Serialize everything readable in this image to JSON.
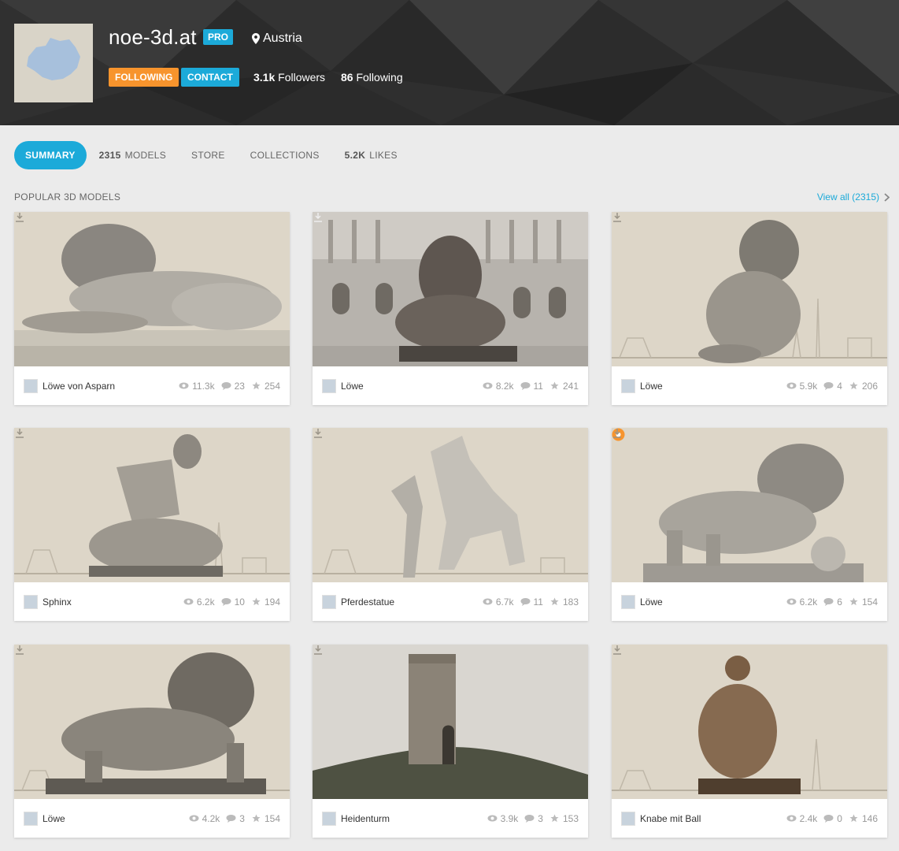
{
  "profile": {
    "name": "noe-3d.at",
    "badge": "PRO",
    "location": "Austria",
    "follow_label": "FOLLOWING",
    "contact_label": "CONTACT",
    "followers_count": "3.1k",
    "followers_label": "Followers",
    "following_count": "86",
    "following_label": "Following"
  },
  "tabs": {
    "summary": "SUMMARY",
    "models_count": "2315",
    "models": "MODELS",
    "store": "STORE",
    "collections": "COLLECTIONS",
    "likes_count": "5.2K",
    "likes": "LIKES"
  },
  "section": {
    "title": "POPULAR 3D MODELS",
    "view_all": "View all (2315)"
  },
  "models": [
    {
      "name": "Löwe von Asparn",
      "views": "11.3k",
      "comments": "23",
      "likes": "254"
    },
    {
      "name": "Löwe",
      "views": "8.2k",
      "comments": "11",
      "likes": "241"
    },
    {
      "name": "Löwe",
      "views": "5.9k",
      "comments": "4",
      "likes": "206"
    },
    {
      "name": "Sphinx",
      "views": "6.2k",
      "comments": "10",
      "likes": "194"
    },
    {
      "name": "Pferdestatue",
      "views": "6.7k",
      "comments": "11",
      "likes": "183"
    },
    {
      "name": "Löwe",
      "views": "6.2k",
      "comments": "6",
      "likes": "154"
    },
    {
      "name": "Löwe",
      "views": "4.2k",
      "comments": "3",
      "likes": "154"
    },
    {
      "name": "Heidenturm",
      "views": "3.9k",
      "comments": "3",
      "likes": "153"
    },
    {
      "name": "Knabe mit Ball",
      "views": "2.4k",
      "comments": "0",
      "likes": "146"
    }
  ],
  "colors": {
    "accent": "#1caad9",
    "following": "#f7942d",
    "header_bg": "#2a2a2a",
    "page_bg": "#ebebeb"
  },
  "icons": {
    "location": "map-pin-icon",
    "views": "eye-icon",
    "comments": "comment-icon",
    "likes": "star-icon",
    "download": "download-icon",
    "staff_pick": "staff-pick-badge-icon"
  }
}
